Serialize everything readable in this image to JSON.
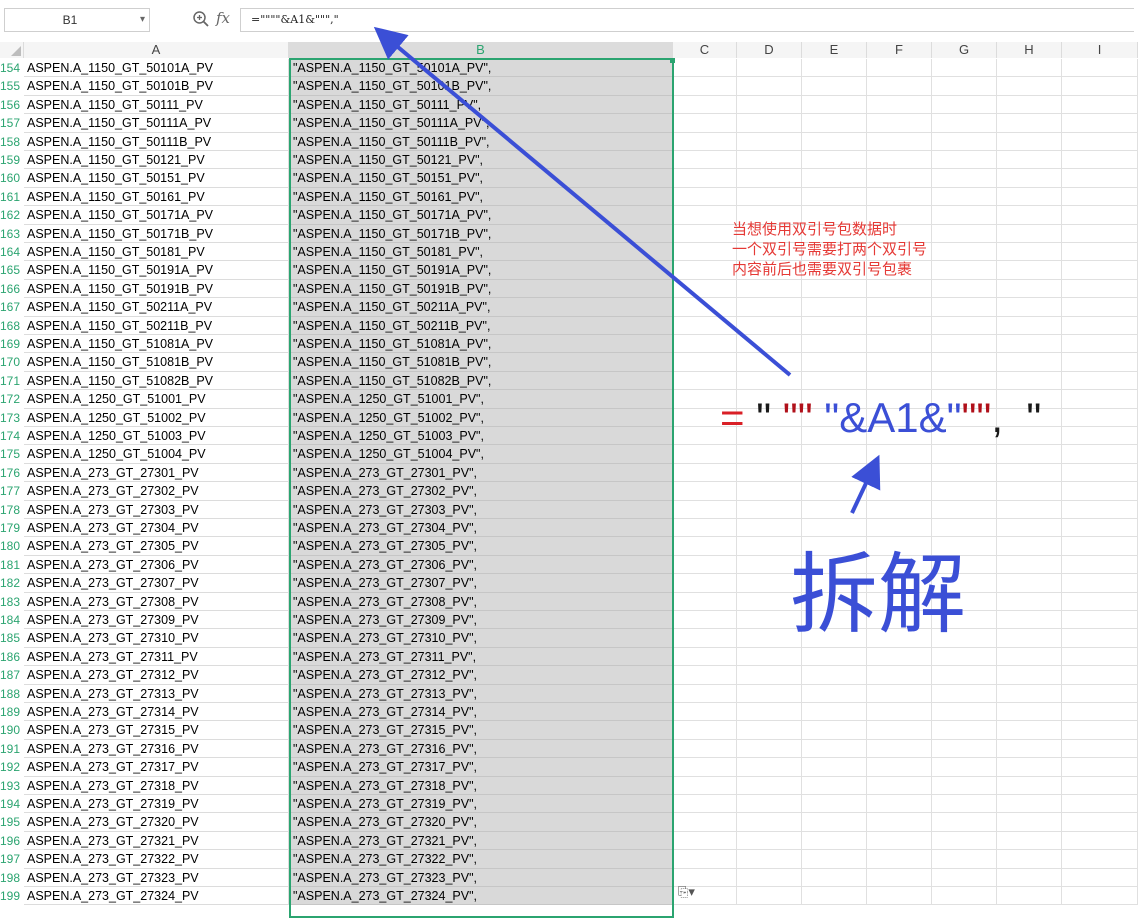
{
  "formula_bar": {
    "name_box": "B1",
    "formula": "=\"\"\"\"&A1&\"\"\",\""
  },
  "columns": [
    {
      "label": "A",
      "sel": false
    },
    {
      "label": "B",
      "sel": true
    },
    {
      "label": "C",
      "sel": false
    },
    {
      "label": "D",
      "sel": false
    },
    {
      "label": "E",
      "sel": false
    },
    {
      "label": "F",
      "sel": false
    },
    {
      "label": "G",
      "sel": false
    },
    {
      "label": "H",
      "sel": false
    },
    {
      "label": "I",
      "sel": false
    }
  ],
  "rows": [
    {
      "n": "154",
      "a": "ASPEN.A_1150_GT_50101A_PV",
      "b": "\"ASPEN.A_1150_GT_50101A_PV\","
    },
    {
      "n": "155",
      "a": "ASPEN.A_1150_GT_50101B_PV",
      "b": "\"ASPEN.A_1150_GT_50101B_PV\","
    },
    {
      "n": "156",
      "a": "ASPEN.A_1150_GT_50111_PV",
      "b": "\"ASPEN.A_1150_GT_50111_PV\","
    },
    {
      "n": "157",
      "a": "ASPEN.A_1150_GT_50111A_PV",
      "b": "\"ASPEN.A_1150_GT_50111A_PV\","
    },
    {
      "n": "158",
      "a": "ASPEN.A_1150_GT_50111B_PV",
      "b": "\"ASPEN.A_1150_GT_50111B_PV\","
    },
    {
      "n": "159",
      "a": "ASPEN.A_1150_GT_50121_PV",
      "b": "\"ASPEN.A_1150_GT_50121_PV\","
    },
    {
      "n": "160",
      "a": "ASPEN.A_1150_GT_50151_PV",
      "b": "\"ASPEN.A_1150_GT_50151_PV\","
    },
    {
      "n": "161",
      "a": "ASPEN.A_1150_GT_50161_PV",
      "b": "\"ASPEN.A_1150_GT_50161_PV\","
    },
    {
      "n": "162",
      "a": "ASPEN.A_1150_GT_50171A_PV",
      "b": "\"ASPEN.A_1150_GT_50171A_PV\","
    },
    {
      "n": "163",
      "a": "ASPEN.A_1150_GT_50171B_PV",
      "b": "\"ASPEN.A_1150_GT_50171B_PV\","
    },
    {
      "n": "164",
      "a": "ASPEN.A_1150_GT_50181_PV",
      "b": "\"ASPEN.A_1150_GT_50181_PV\","
    },
    {
      "n": "165",
      "a": "ASPEN.A_1150_GT_50191A_PV",
      "b": "\"ASPEN.A_1150_GT_50191A_PV\","
    },
    {
      "n": "166",
      "a": "ASPEN.A_1150_GT_50191B_PV",
      "b": "\"ASPEN.A_1150_GT_50191B_PV\","
    },
    {
      "n": "167",
      "a": "ASPEN.A_1150_GT_50211A_PV",
      "b": "\"ASPEN.A_1150_GT_50211A_PV\","
    },
    {
      "n": "168",
      "a": "ASPEN.A_1150_GT_50211B_PV",
      "b": "\"ASPEN.A_1150_GT_50211B_PV\","
    },
    {
      "n": "169",
      "a": "ASPEN.A_1150_GT_51081A_PV",
      "b": "\"ASPEN.A_1150_GT_51081A_PV\","
    },
    {
      "n": "170",
      "a": "ASPEN.A_1150_GT_51081B_PV",
      "b": "\"ASPEN.A_1150_GT_51081B_PV\","
    },
    {
      "n": "171",
      "a": "ASPEN.A_1150_GT_51082B_PV",
      "b": "\"ASPEN.A_1150_GT_51082B_PV\","
    },
    {
      "n": "172",
      "a": "ASPEN.A_1250_GT_51001_PV",
      "b": "\"ASPEN.A_1250_GT_51001_PV\","
    },
    {
      "n": "173",
      "a": "ASPEN.A_1250_GT_51002_PV",
      "b": "\"ASPEN.A_1250_GT_51002_PV\","
    },
    {
      "n": "174",
      "a": "ASPEN.A_1250_GT_51003_PV",
      "b": "\"ASPEN.A_1250_GT_51003_PV\","
    },
    {
      "n": "175",
      "a": "ASPEN.A_1250_GT_51004_PV",
      "b": "\"ASPEN.A_1250_GT_51004_PV\","
    },
    {
      "n": "176",
      "a": "ASPEN.A_273_GT_27301_PV",
      "b": "\"ASPEN.A_273_GT_27301_PV\","
    },
    {
      "n": "177",
      "a": "ASPEN.A_273_GT_27302_PV",
      "b": "\"ASPEN.A_273_GT_27302_PV\","
    },
    {
      "n": "178",
      "a": "ASPEN.A_273_GT_27303_PV",
      "b": "\"ASPEN.A_273_GT_27303_PV\","
    },
    {
      "n": "179",
      "a": "ASPEN.A_273_GT_27304_PV",
      "b": "\"ASPEN.A_273_GT_27304_PV\","
    },
    {
      "n": "180",
      "a": "ASPEN.A_273_GT_27305_PV",
      "b": "\"ASPEN.A_273_GT_27305_PV\","
    },
    {
      "n": "181",
      "a": "ASPEN.A_273_GT_27306_PV",
      "b": "\"ASPEN.A_273_GT_27306_PV\","
    },
    {
      "n": "182",
      "a": "ASPEN.A_273_GT_27307_PV",
      "b": "\"ASPEN.A_273_GT_27307_PV\","
    },
    {
      "n": "183",
      "a": "ASPEN.A_273_GT_27308_PV",
      "b": "\"ASPEN.A_273_GT_27308_PV\","
    },
    {
      "n": "184",
      "a": "ASPEN.A_273_GT_27309_PV",
      "b": "\"ASPEN.A_273_GT_27309_PV\","
    },
    {
      "n": "185",
      "a": "ASPEN.A_273_GT_27310_PV",
      "b": "\"ASPEN.A_273_GT_27310_PV\","
    },
    {
      "n": "186",
      "a": "ASPEN.A_273_GT_27311_PV",
      "b": "\"ASPEN.A_273_GT_27311_PV\","
    },
    {
      "n": "187",
      "a": "ASPEN.A_273_GT_27312_PV",
      "b": "\"ASPEN.A_273_GT_27312_PV\","
    },
    {
      "n": "188",
      "a": "ASPEN.A_273_GT_27313_PV",
      "b": "\"ASPEN.A_273_GT_27313_PV\","
    },
    {
      "n": "189",
      "a": "ASPEN.A_273_GT_27314_PV",
      "b": "\"ASPEN.A_273_GT_27314_PV\","
    },
    {
      "n": "190",
      "a": "ASPEN.A_273_GT_27315_PV",
      "b": "\"ASPEN.A_273_GT_27315_PV\","
    },
    {
      "n": "191",
      "a": "ASPEN.A_273_GT_27316_PV",
      "b": "\"ASPEN.A_273_GT_27316_PV\","
    },
    {
      "n": "192",
      "a": "ASPEN.A_273_GT_27317_PV",
      "b": "\"ASPEN.A_273_GT_27317_PV\","
    },
    {
      "n": "193",
      "a": "ASPEN.A_273_GT_27318_PV",
      "b": "\"ASPEN.A_273_GT_27318_PV\","
    },
    {
      "n": "194",
      "a": "ASPEN.A_273_GT_27319_PV",
      "b": "\"ASPEN.A_273_GT_27319_PV\","
    },
    {
      "n": "195",
      "a": "ASPEN.A_273_GT_27320_PV",
      "b": "\"ASPEN.A_273_GT_27320_PV\","
    },
    {
      "n": "196",
      "a": "ASPEN.A_273_GT_27321_PV",
      "b": "\"ASPEN.A_273_GT_27321_PV\","
    },
    {
      "n": "197",
      "a": "ASPEN.A_273_GT_27322_PV",
      "b": "\"ASPEN.A_273_GT_27322_PV\","
    },
    {
      "n": "198",
      "a": "ASPEN.A_273_GT_27323_PV",
      "b": "\"ASPEN.A_273_GT_27323_PV\","
    },
    {
      "n": "199",
      "a": "ASPEN.A_273_GT_27324_PV",
      "b": "\"ASPEN.A_273_GT_27324_PV\","
    }
  ],
  "annotation": {
    "note_lines": [
      "当想使用双引号包数据时",
      "一个双引号需要打两个双引号",
      "内容前后也需要双引号包裹"
    ],
    "breakdown": {
      "eq": "=",
      "q1": "\"",
      "q2": "\"\"",
      "mid": "\"&A1&\"",
      "q3": "\"\"",
      "comma": ",",
      "q4": "\""
    },
    "label": "拆解",
    "note_color": "#e53935",
    "arrow_color": "#3b4fd6"
  },
  "icons": {
    "zoom": "zoom-formula-icon",
    "fx": "fx-icon",
    "paste": "paste-options-icon"
  }
}
